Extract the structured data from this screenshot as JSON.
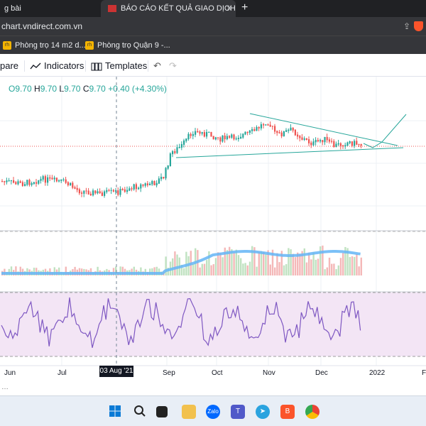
{
  "browser": {
    "tab1_title": "g bài",
    "tab2_title": "BÁO CÁO KẾT QUẢ GIAO DỊCH CỔ PH",
    "tab2_close": "×",
    "new_tab": "+",
    "url": "chart.vndirect.com.vn",
    "bookmarks": [
      {
        "label": "Phòng trọ 14 m2 d...",
        "icon": "rentalhouse-icon"
      },
      {
        "label": "Phòng trọ Quận 9 -...",
        "icon": "rentalhouse-icon"
      }
    ]
  },
  "toolbar": {
    "compare": "pare",
    "indicators": "Indicators",
    "templates": "Templates"
  },
  "legend": {
    "open_label": "O",
    "open": "9.70",
    "high_label": "H",
    "high": "9.70",
    "low_label": "L",
    "low": "9.70",
    "close_label": "C",
    "close": "9.70",
    "change": "+0.40 (+4.30%)"
  },
  "crosshair_date": "03 Aug '21",
  "chart_data": {
    "type": "line",
    "description_series": [
      "price",
      "volume",
      "rsi"
    ],
    "x_labels": [
      "Jun",
      "Jul",
      "03 Aug '21",
      "Sep",
      "Oct",
      "Nov",
      "Dec",
      "2022",
      "F"
    ],
    "last_price": 9.7,
    "price_level_line": 9.7
  },
  "colors": {
    "up": "#26a69a",
    "down": "#ef5350",
    "rsi_bg": "#f3e5f5",
    "rsi_line": "#7e57c2",
    "volume_ma": "#64b5f6",
    "trendline": "#26a69a"
  },
  "taskbar_icons": [
    "windows-start-icon",
    "search-icon",
    "task-view-icon",
    "file-explorer-icon",
    "zalo-icon",
    "teams-icon",
    "telegram-icon",
    "brave-icon",
    "chrome-icon"
  ]
}
